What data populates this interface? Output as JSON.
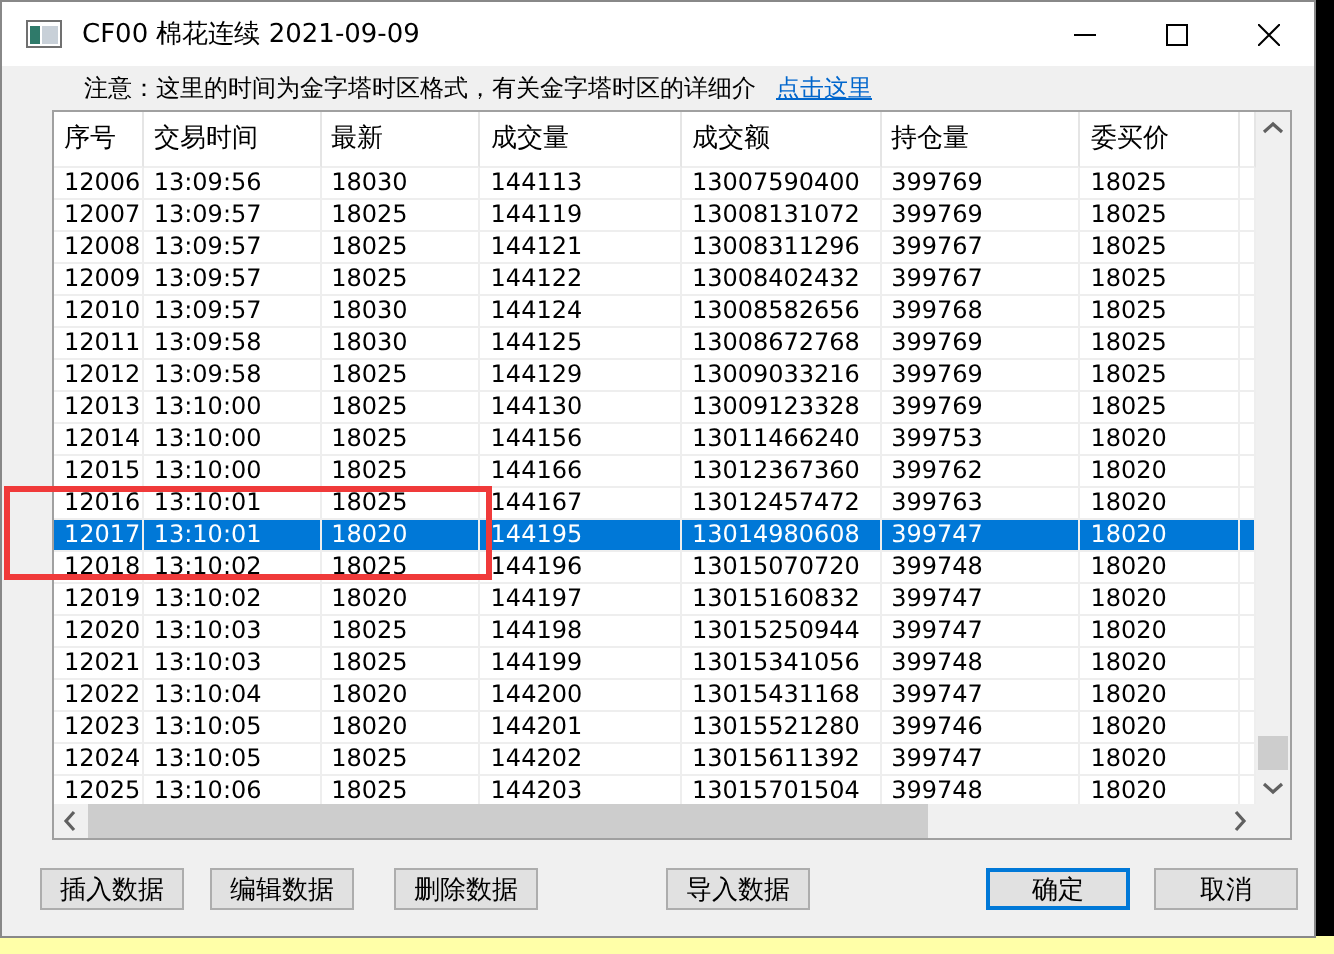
{
  "window": {
    "title": "CF00 棉花连续 2021-09-09"
  },
  "notice": {
    "text": "注意：这里的时间为金字塔时区格式，有关金字塔时区的详细介",
    "link": "点击这里"
  },
  "table": {
    "columns": [
      "序号",
      "交易时间",
      "最新",
      "成交量",
      "成交额",
      "持仓量",
      "委买价"
    ],
    "rows": [
      {
        "cells": [
          "12006",
          "13:09:56",
          "18030",
          "144113",
          "13007590400",
          "399769",
          "18025"
        ],
        "selected": false
      },
      {
        "cells": [
          "12007",
          "13:09:57",
          "18025",
          "144119",
          "13008131072",
          "399769",
          "18025"
        ],
        "selected": false
      },
      {
        "cells": [
          "12008",
          "13:09:57",
          "18025",
          "144121",
          "13008311296",
          "399767",
          "18025"
        ],
        "selected": false
      },
      {
        "cells": [
          "12009",
          "13:09:57",
          "18025",
          "144122",
          "13008402432",
          "399767",
          "18025"
        ],
        "selected": false
      },
      {
        "cells": [
          "12010",
          "13:09:57",
          "18030",
          "144124",
          "13008582656",
          "399768",
          "18025"
        ],
        "selected": false
      },
      {
        "cells": [
          "12011",
          "13:09:58",
          "18030",
          "144125",
          "13008672768",
          "399769",
          "18025"
        ],
        "selected": false
      },
      {
        "cells": [
          "12012",
          "13:09:58",
          "18025",
          "144129",
          "13009033216",
          "399769",
          "18025"
        ],
        "selected": false
      },
      {
        "cells": [
          "12013",
          "13:10:00",
          "18025",
          "144130",
          "13009123328",
          "399769",
          "18025"
        ],
        "selected": false
      },
      {
        "cells": [
          "12014",
          "13:10:00",
          "18025",
          "144156",
          "13011466240",
          "399753",
          "18020"
        ],
        "selected": false
      },
      {
        "cells": [
          "12015",
          "13:10:00",
          "18025",
          "144166",
          "13012367360",
          "399762",
          "18020"
        ],
        "selected": false
      },
      {
        "cells": [
          "12016",
          "13:10:01",
          "18025",
          "144167",
          "13012457472",
          "399763",
          "18020"
        ],
        "selected": false
      },
      {
        "cells": [
          "12017",
          "13:10:01",
          "18020",
          "144195",
          "13014980608",
          "399747",
          "18020"
        ],
        "selected": true
      },
      {
        "cells": [
          "12018",
          "13:10:02",
          "18025",
          "144196",
          "13015070720",
          "399748",
          "18020"
        ],
        "selected": false
      },
      {
        "cells": [
          "12019",
          "13:10:02",
          "18020",
          "144197",
          "13015160832",
          "399747",
          "18020"
        ],
        "selected": false
      },
      {
        "cells": [
          "12020",
          "13:10:03",
          "18025",
          "144198",
          "13015250944",
          "399747",
          "18020"
        ],
        "selected": false
      },
      {
        "cells": [
          "12021",
          "13:10:03",
          "18025",
          "144199",
          "13015341056",
          "399748",
          "18020"
        ],
        "selected": false
      },
      {
        "cells": [
          "12022",
          "13:10:04",
          "18020",
          "144200",
          "13015431168",
          "399747",
          "18020"
        ],
        "selected": false
      },
      {
        "cells": [
          "12023",
          "13:10:05",
          "18020",
          "144201",
          "13015521280",
          "399746",
          "18020"
        ],
        "selected": false
      },
      {
        "cells": [
          "12024",
          "13:10:05",
          "18025",
          "144202",
          "13015611392",
          "399747",
          "18020"
        ],
        "selected": false
      },
      {
        "cells": [
          "12025",
          "13:10:06",
          "18025",
          "144203",
          "13015701504",
          "399748",
          "18020"
        ],
        "selected": false
      }
    ]
  },
  "buttons": [
    {
      "label": "插入数据",
      "default": false
    },
    {
      "label": "编辑数据",
      "default": false
    },
    {
      "label": "删除数据",
      "default": false
    },
    {
      "label": "导入数据",
      "default": false
    },
    {
      "label": "确定",
      "default": true
    },
    {
      "label": "取消",
      "default": false
    }
  ]
}
